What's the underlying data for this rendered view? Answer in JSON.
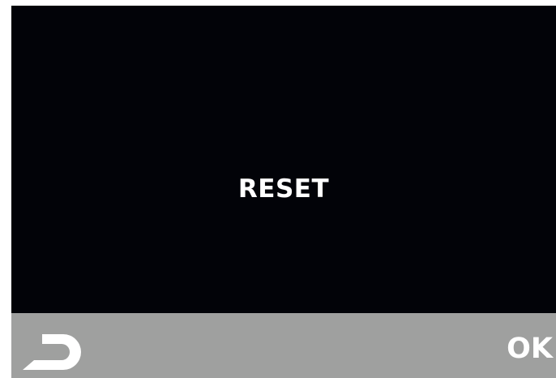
{
  "screen": {
    "message": "RESET"
  },
  "softkeys": {
    "back_icon": "return-icon",
    "ok_label": "OK"
  },
  "colors": {
    "screen_background": "#020308",
    "softkey_bar": "#9fa09f",
    "text": "#ffffff"
  }
}
